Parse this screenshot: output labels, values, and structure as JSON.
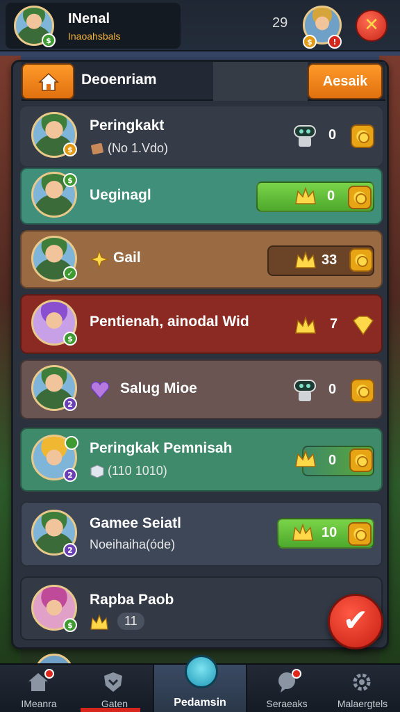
{
  "topbar": {
    "player_name": "INenal",
    "player_sub": "Inaoahsbals",
    "player_badge": "$",
    "count": "29",
    "friend_badges": [
      "$",
      "!"
    ],
    "close_glyph": "✕"
  },
  "panel": {
    "header_title": "Deoenriam",
    "action_label": "Aesaik"
  },
  "rows": [
    {
      "title": "Peringkakt",
      "sub": "(No 1.Vdo)",
      "badge": "$",
      "score": "0",
      "color": "#3a4150"
    },
    {
      "title": "Ueginagl",
      "sub": "",
      "badge": "$",
      "score": "0",
      "color": "#3f8f7a"
    },
    {
      "title": "Gail",
      "sub": "",
      "badge": "✓",
      "score": "33",
      "color": "#9a6a43"
    },
    {
      "title": "Pentienah, ainodal Wid",
      "sub": "",
      "badge": "$",
      "score": "7",
      "color": "#8a2a22"
    },
    {
      "title": "Salug Mioe",
      "sub": "",
      "badge": "2",
      "score": "0",
      "color": "#6a5552"
    },
    {
      "title": "Peringkak Pemnisah",
      "sub": "(110 1010)",
      "badge": "2",
      "score": "0",
      "color": "#3f8a6a"
    },
    {
      "title": "Gamee Seiatl",
      "sub": "Noeihaiha(óde)",
      "badge": "2",
      "score": "10",
      "color": "#3e4758"
    },
    {
      "title": "Rapba Paob",
      "sub": "11",
      "badge": "$",
      "score": "",
      "color": "#333a46"
    }
  ],
  "confirm_glyph": "✔",
  "nav": [
    {
      "label": "IMeanra"
    },
    {
      "label": "Gaten"
    },
    {
      "label": "Pedamsin"
    },
    {
      "label": "Seraeaks"
    },
    {
      "label": "Malaergtels"
    }
  ],
  "colors": {
    "accent_orange": "#f08a1c",
    "green_bar": "#5fc43a",
    "danger_red": "#d7261c",
    "gold": "#ffd84a"
  }
}
